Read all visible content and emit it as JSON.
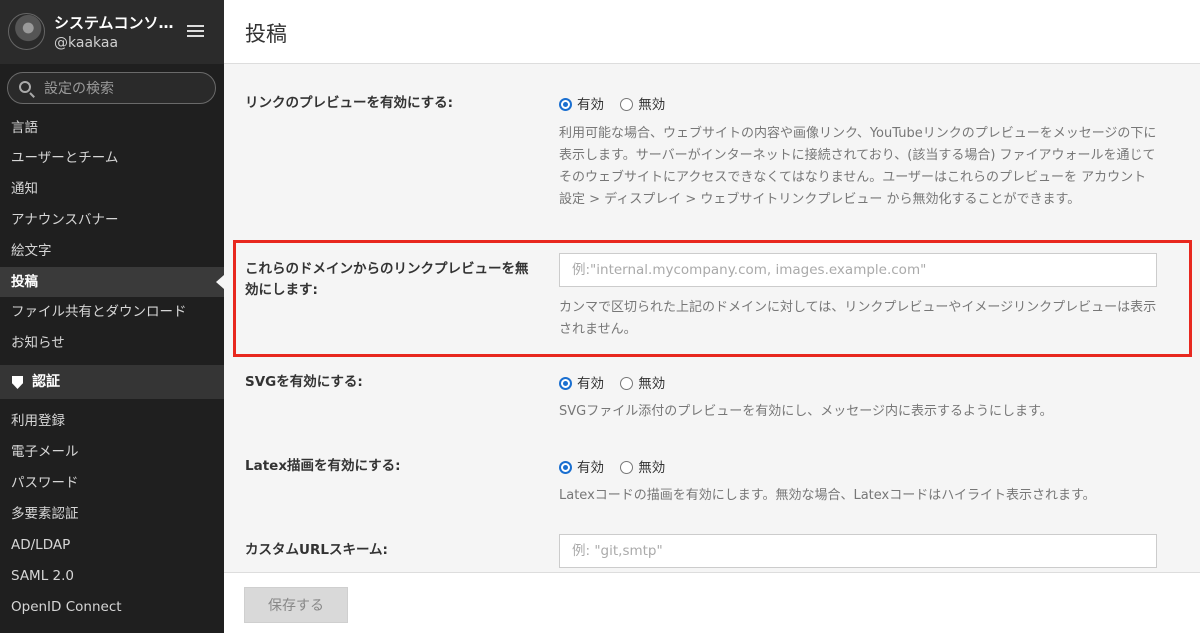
{
  "sidebar": {
    "title": "システムコンソ…",
    "username": "@kaakaa",
    "search_placeholder": "設定の検索",
    "items": [
      {
        "label": "言語"
      },
      {
        "label": "ユーザーとチーム"
      },
      {
        "label": "通知"
      },
      {
        "label": "アナウンスバナー"
      },
      {
        "label": "絵文字"
      },
      {
        "label": "投稿",
        "active": true
      },
      {
        "label": "ファイル共有とダウンロード"
      },
      {
        "label": "お知らせ"
      }
    ],
    "section": {
      "label": "認証",
      "icon": "shield-icon"
    },
    "auth_items": [
      {
        "label": "利用登録"
      },
      {
        "label": "電子メール"
      },
      {
        "label": "パスワード"
      },
      {
        "label": "多要素認証"
      },
      {
        "label": "AD/LDAP"
      },
      {
        "label": "SAML 2.0"
      },
      {
        "label": "OpenID Connect"
      }
    ]
  },
  "page": {
    "title": "投稿"
  },
  "settings": {
    "link_preview": {
      "label": "リンクのプレビューを有効にする:",
      "option_true": "有効",
      "option_false": "無効",
      "selected": "有効",
      "help": "利用可能な場合、ウェブサイトの内容や画像リンク、YouTubeリンクのプレビューをメッセージの下に表示します。サーバーがインターネットに接続されており、(該当する場合) ファイアウォールを通じてそのウェブサイトにアクセスできなくてはなりません。ユーザーはこれらのプレビューを アカウント設定 > ディスプレイ > ウェブサイトリンクプレビュー から無効化することができます。"
    },
    "disabled_domains": {
      "label": "これらのドメインからのリンクプレビューを無効にします:",
      "placeholder": "例:\"internal.mycompany.com, images.example.com\"",
      "value": "",
      "help": "カンマで区切られた上記のドメインに対しては、リンクプレビューやイメージリンクプレビューは表示されません。"
    },
    "svg": {
      "label": "SVGを有効にする:",
      "option_true": "有効",
      "option_false": "無効",
      "selected": "有効",
      "help": "SVGファイル添付のプレビューを有効にし、メッセージ内に表示するようにします。"
    },
    "latex": {
      "label": "Latex描画を有効にする:",
      "option_true": "有効",
      "option_false": "無効",
      "selected": "有効",
      "help": "Latexコードの描画を有効にします。無効な場合、Latexコードはハイライト表示されます。"
    },
    "custom_url_schemes": {
      "label": "カスタムURLスキーム:",
      "placeholder": "例: \"git,smtp\"",
      "value": ""
    }
  },
  "footer": {
    "save_label": "保存する"
  }
}
